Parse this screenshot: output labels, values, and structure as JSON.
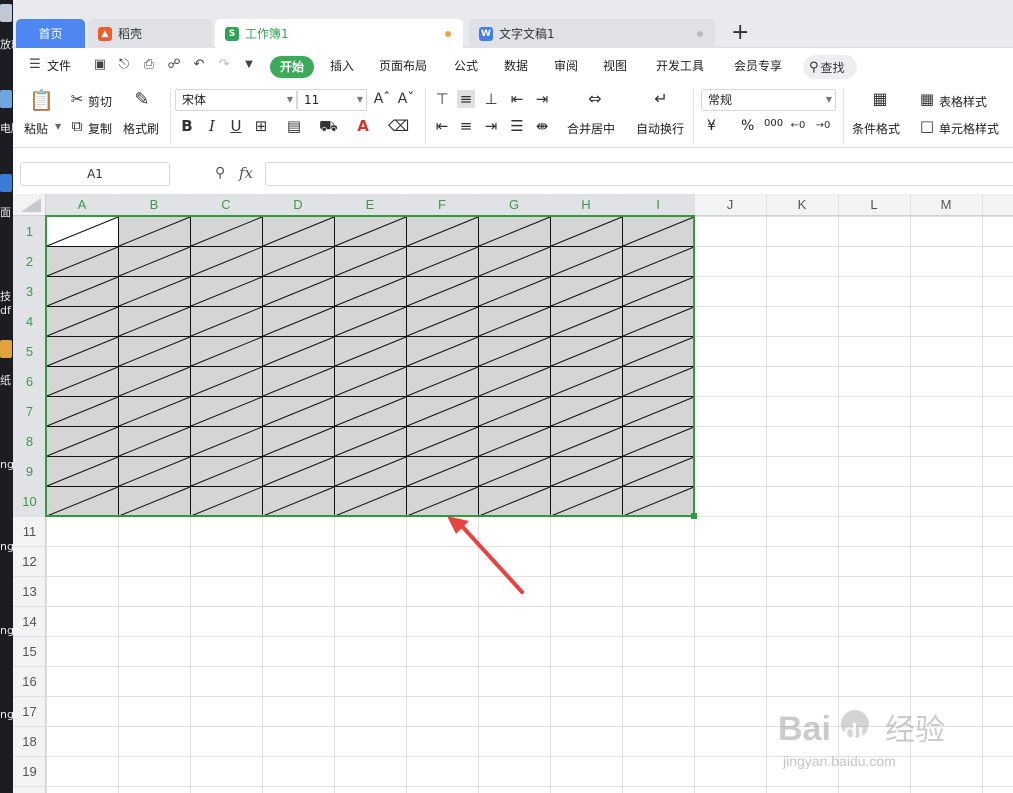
{
  "desktop": {
    "fragments": [
      "放就",
      "电脑",
      "面",
      "技",
      "df",
      "纸",
      "ng",
      "ng",
      "ng",
      "ng"
    ]
  },
  "tabs": {
    "home": "首页",
    "shell": "稻壳",
    "workbook": "工作簿1",
    "doc": "文字文稿1",
    "add": "+"
  },
  "menu": {
    "file": "文件",
    "start": "开始",
    "items": [
      "插入",
      "页面布局",
      "公式",
      "数据",
      "审阅",
      "视图",
      "开发工具",
      "会员专享"
    ],
    "search": "查找"
  },
  "ribbon": {
    "cut": "剪切",
    "paste": "粘贴",
    "copy": "复制",
    "format_painter": "格式刷",
    "font_name": "宋体",
    "font_size": "11",
    "merge_center": "合并居中",
    "wrap_text": "自动换行",
    "number_format": "常规",
    "currency": "¥",
    "percent": "%",
    "thousands": "000",
    "cond_format": "条件格式",
    "table_style": "表格样式",
    "cell_style": "单元格样式"
  },
  "formula_bar": {
    "name_box": "A1",
    "fx": "fx",
    "value": ""
  },
  "sheet": {
    "columns": [
      "A",
      "B",
      "C",
      "D",
      "E",
      "F",
      "G",
      "H",
      "I",
      "J",
      "K",
      "L",
      "M"
    ],
    "rows": [
      "1",
      "2",
      "3",
      "4",
      "5",
      "6",
      "7",
      "8",
      "9",
      "10",
      "11",
      "12",
      "13",
      "14",
      "15",
      "16",
      "17",
      "18",
      "19"
    ],
    "selection_cols": 9,
    "selection_rows": 10
  },
  "watermark": {
    "brand": "Bai",
    "brand2": "du",
    "cn": "经验",
    "url": "jingyan.baidu.com"
  },
  "colors": {
    "accent_green": "#3bab5a",
    "grid_line": "#e1e1e1",
    "selection_fill": "#d5d5d5",
    "selection_border": "#2e9c3e",
    "arrow": "#e84341",
    "tab_home": "#4e87f1"
  }
}
